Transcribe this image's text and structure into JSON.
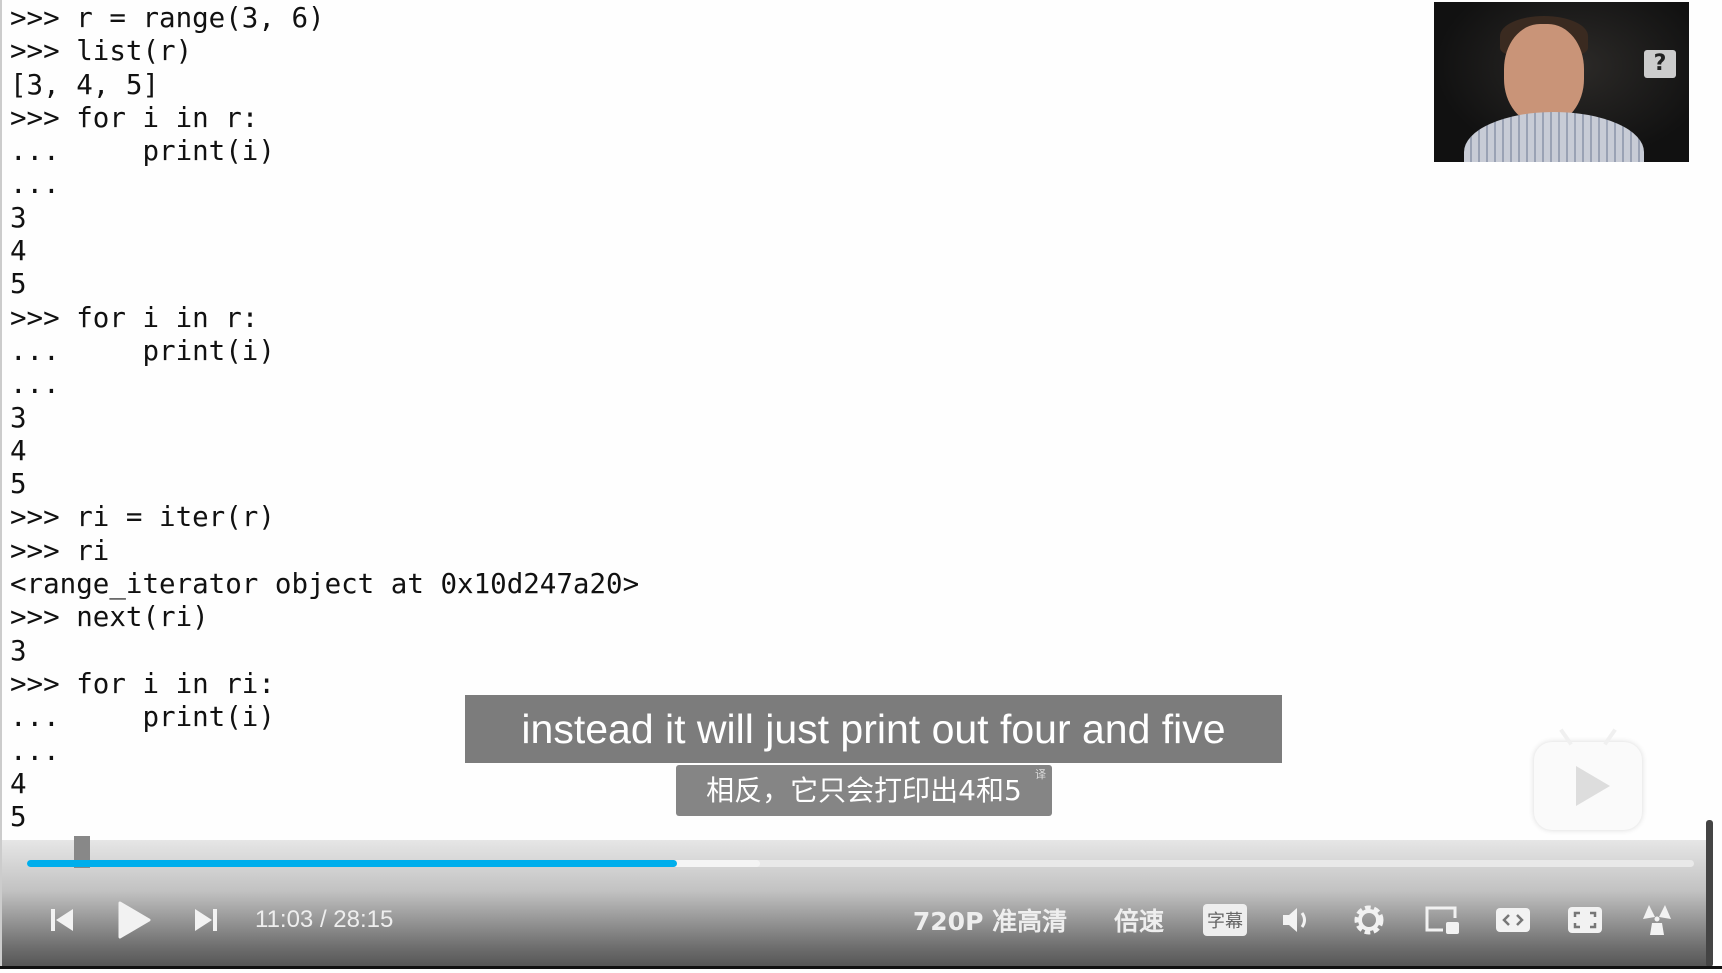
{
  "terminal": {
    "lines": [
      ">>> r = range(3, 6)",
      ">>> list(r)",
      "[3, 4, 5]",
      ">>> for i in r:",
      "...     print(i)",
      "...",
      "3",
      "4",
      "5",
      ">>> for i in r:",
      "...     print(i)",
      "...",
      "3",
      "4",
      "5",
      ">>> ri = iter(r)",
      ">>> ri",
      "<range_iterator object at 0x10d247a20>",
      ">>> next(ri)",
      "3",
      ">>> for i in ri:",
      "...     print(i)",
      "...",
      "4",
      "5",
      ">>>"
    ]
  },
  "webcam": {
    "help_icon": "?"
  },
  "subtitles": {
    "english": "instead it will just print out four and five",
    "chinese": "相反，它只会打印出4和5",
    "translated_marker": "译"
  },
  "player": {
    "progress_percent": 39,
    "buffered_percent": 44,
    "accent_color": "#00aeec",
    "current_time": "11:03",
    "separator": "/",
    "duration": "28:15",
    "quality": "720P 准高清",
    "speed": "倍速",
    "subtitle_button": "字幕"
  }
}
